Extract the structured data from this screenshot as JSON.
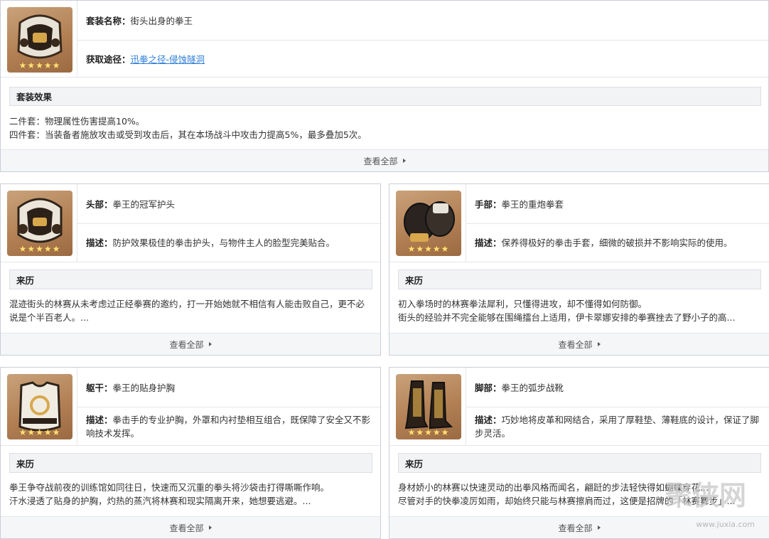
{
  "set": {
    "name_label": "套装名称：",
    "name_value": "街头出身的拳王",
    "source_label": "获取途径：",
    "source_link": "迅拳之径-侵蚀隧洞",
    "icon": "boxing-helmet-icon",
    "rarity": 5,
    "stars": "★★★★★",
    "effect_title": "套装效果",
    "effect_lines": [
      "二件套：物理属性伤害提高10%。",
      "四件套：当装备者施放攻击或受到攻击后，其在本场战斗中攻击力提高5%，最多叠加5次。"
    ],
    "more_label": "查看全部"
  },
  "pieces": [
    {
      "slot_label": "头部：",
      "name": "拳王的冠军护头",
      "desc_label": "描述：",
      "desc": "防护效果极佳的拳击护头，与物件主人的脸型完美贴合。",
      "icon": "boxing-helmet-icon",
      "stars": "★★★★★",
      "story_title": "来历",
      "story": "混迹街头的林赛从未考虑过正经拳赛的邀约，打一开始她就不相信有人能击败自己，更不必说是个半百老人。...",
      "more_label": "查看全部"
    },
    {
      "slot_label": "手部：",
      "name": "拳王的重炮拳套",
      "desc_label": "描述：",
      "desc": "保养得极好的拳击手套，细微的破损并不影响实际的使用。",
      "icon": "boxing-gloves-icon",
      "stars": "★★★★★",
      "story_title": "来历",
      "story_lines": [
        "初入拳场时的林赛拳法犀利，只懂得进攻，却不懂得如何防御。",
        "街头的经验并不完全能够在围绳擂台上适用，伊卡翠娜安排的拳赛挫去了野小子的高..."
      ],
      "more_label": "查看全部"
    },
    {
      "slot_label": "躯干：",
      "name": "拳王的贴身护胸",
      "desc_label": "描述：",
      "desc": "拳击手的专业护胸，外罩和内衬垫相互组合，既保障了安全又不影响技术发挥。",
      "icon": "chest-guard-icon",
      "stars": "★★★★★",
      "story_title": "来历",
      "story_lines": [
        "拳王争夺战前夜的训练馆如同往日，快速而又沉重的拳头将沙袋击打得嘶嘶作响。",
        "汗水浸透了贴身的护胸，灼热的蒸汽将林赛和现实隔离开来，她想要逃避。..."
      ],
      "more_label": "查看全部"
    },
    {
      "slot_label": "脚部：",
      "name": "拳王的弧步战靴",
      "desc_label": "描述：",
      "desc": "巧妙地将皮革和网结合，采用了厚鞋垫、薄鞋底的设计，保证了脚步灵活。",
      "icon": "boxing-boots-icon",
      "stars": "★★★★★",
      "story_title": "来历",
      "story_lines": [
        "身材娇小的林赛以快速灵动的出拳风格而闻名，翩跹的步法轻快得如蝴蝶穿花...",
        "尽管对手的快拳凌厉如雨，却始终只能与林赛擦肩而过，这便是招牌的「林赛舞步」..."
      ],
      "more_label": "查看全部"
    }
  ],
  "watermark": {
    "logo_text": "聚侠网",
    "url": "www.juxia.com"
  },
  "colors": {
    "link": "#2f7fd8",
    "border": "#c9ced6",
    "section_bg": "#f2f3f5",
    "icon_bg": "#b38055",
    "star": "#ffe27a"
  }
}
